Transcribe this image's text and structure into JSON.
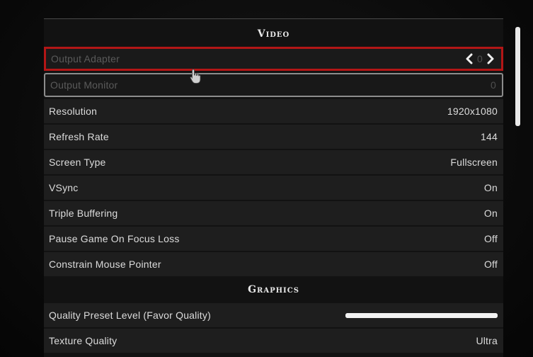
{
  "sections": {
    "video": "Video",
    "graphics": "Graphics"
  },
  "rows": {
    "output_adapter": {
      "label": "Output Adapter",
      "value": "0"
    },
    "output_monitor": {
      "label": "Output Monitor",
      "value": "0"
    },
    "resolution": {
      "label": "Resolution",
      "value": "1920x1080"
    },
    "refresh_rate": {
      "label": "Refresh Rate",
      "value": "144"
    },
    "screen_type": {
      "label": "Screen Type",
      "value": "Fullscreen"
    },
    "vsync": {
      "label": "VSync",
      "value": "On"
    },
    "triple_buffering": {
      "label": "Triple Buffering",
      "value": "On"
    },
    "pause_game": {
      "label": "Pause Game On Focus Loss",
      "value": "Off"
    },
    "constrain_mouse": {
      "label": "Constrain Mouse Pointer",
      "value": "Off"
    },
    "quality_preset": {
      "label": "Quality Preset Level (Favor Quality)",
      "slider_fraction": 1.0
    },
    "texture_quality": {
      "label": "Texture Quality",
      "value": "Ultra"
    }
  },
  "colors": {
    "selection_border": "#b31616",
    "hover_outline": "#8c8c8c",
    "row_background": "#1e1e1e",
    "text": "#dcdcdc",
    "disabled_text": "#5a5a5a"
  },
  "icons": {
    "left_arrow": "chevron-left-icon",
    "right_arrow": "chevron-right-icon",
    "cursor": "hand-cursor-icon"
  }
}
